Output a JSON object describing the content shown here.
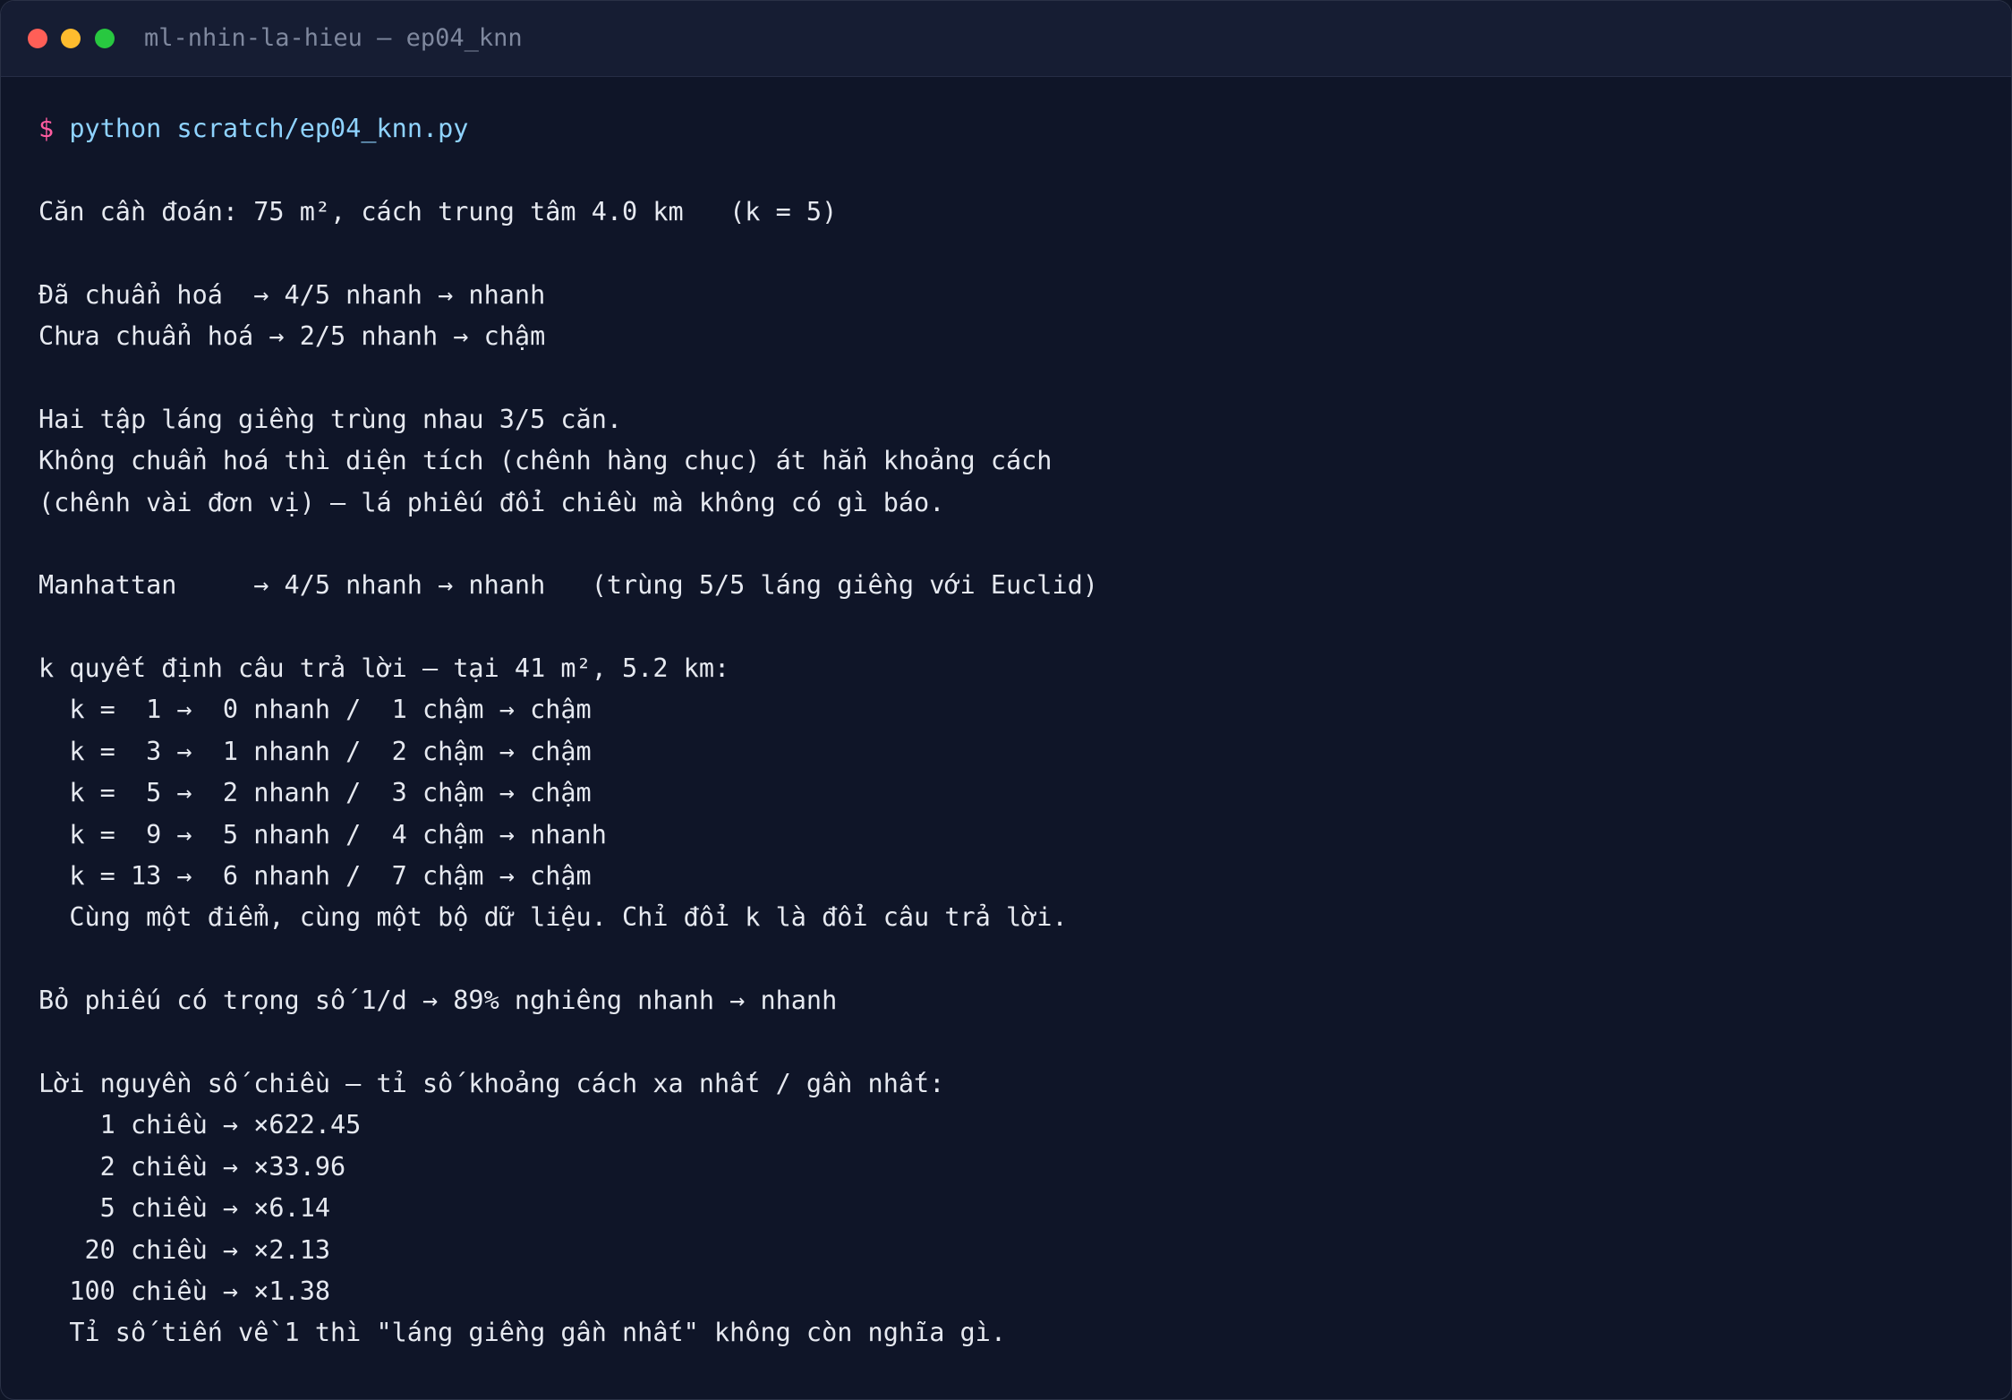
{
  "window": {
    "title": "ml-nhin-la-hieu — ep04_knn"
  },
  "terminal": {
    "prompt_symbol": "$",
    "command": "python scratch/ep04_knn.py",
    "output_lines": [
      "",
      "Căn cần đoán: 75 m², cách trung tâm 4.0 km   (k = 5)",
      "",
      "Đã chuẩn hoá  → 4/5 nhanh → nhanh",
      "Chưa chuẩn hoá → 2/5 nhanh → chậm",
      "",
      "Hai tập láng giềng trùng nhau 3/5 căn.",
      "Không chuẩn hoá thì diện tích (chênh hàng chục) át hẳn khoảng cách",
      "(chênh vài đơn vị) — lá phiếu đổi chiều mà không có gì báo.",
      "",
      "Manhattan     → 4/5 nhanh → nhanh   (trùng 5/5 láng giềng với Euclid)",
      "",
      "k quyết định câu trả lời — tại 41 m², 5.2 km:",
      "  k =  1 →  0 nhanh /  1 chậm → chậm",
      "  k =  3 →  1 nhanh /  2 chậm → chậm",
      "  k =  5 →  2 nhanh /  3 chậm → chậm",
      "  k =  9 →  5 nhanh /  4 chậm → nhanh",
      "  k = 13 →  6 nhanh /  7 chậm → chậm",
      "  Cùng một điểm, cùng một bộ dữ liệu. Chỉ đổi k là đổi câu trả lời.",
      "",
      "Bỏ phiếu có trọng số 1/d → 89% nghiêng nhanh → nhanh",
      "",
      "Lời nguyền số chiều — tỉ số khoảng cách xa nhất / gần nhất:",
      "    1 chiều → ×622.45",
      "    2 chiều → ×33.96",
      "    5 chiều → ×6.14",
      "   20 chiều → ×2.13",
      "  100 chiều → ×1.38",
      "  Tỉ số tiến về 1 thì \"láng giềng gần nhất\" không còn nghĩa gì."
    ]
  }
}
